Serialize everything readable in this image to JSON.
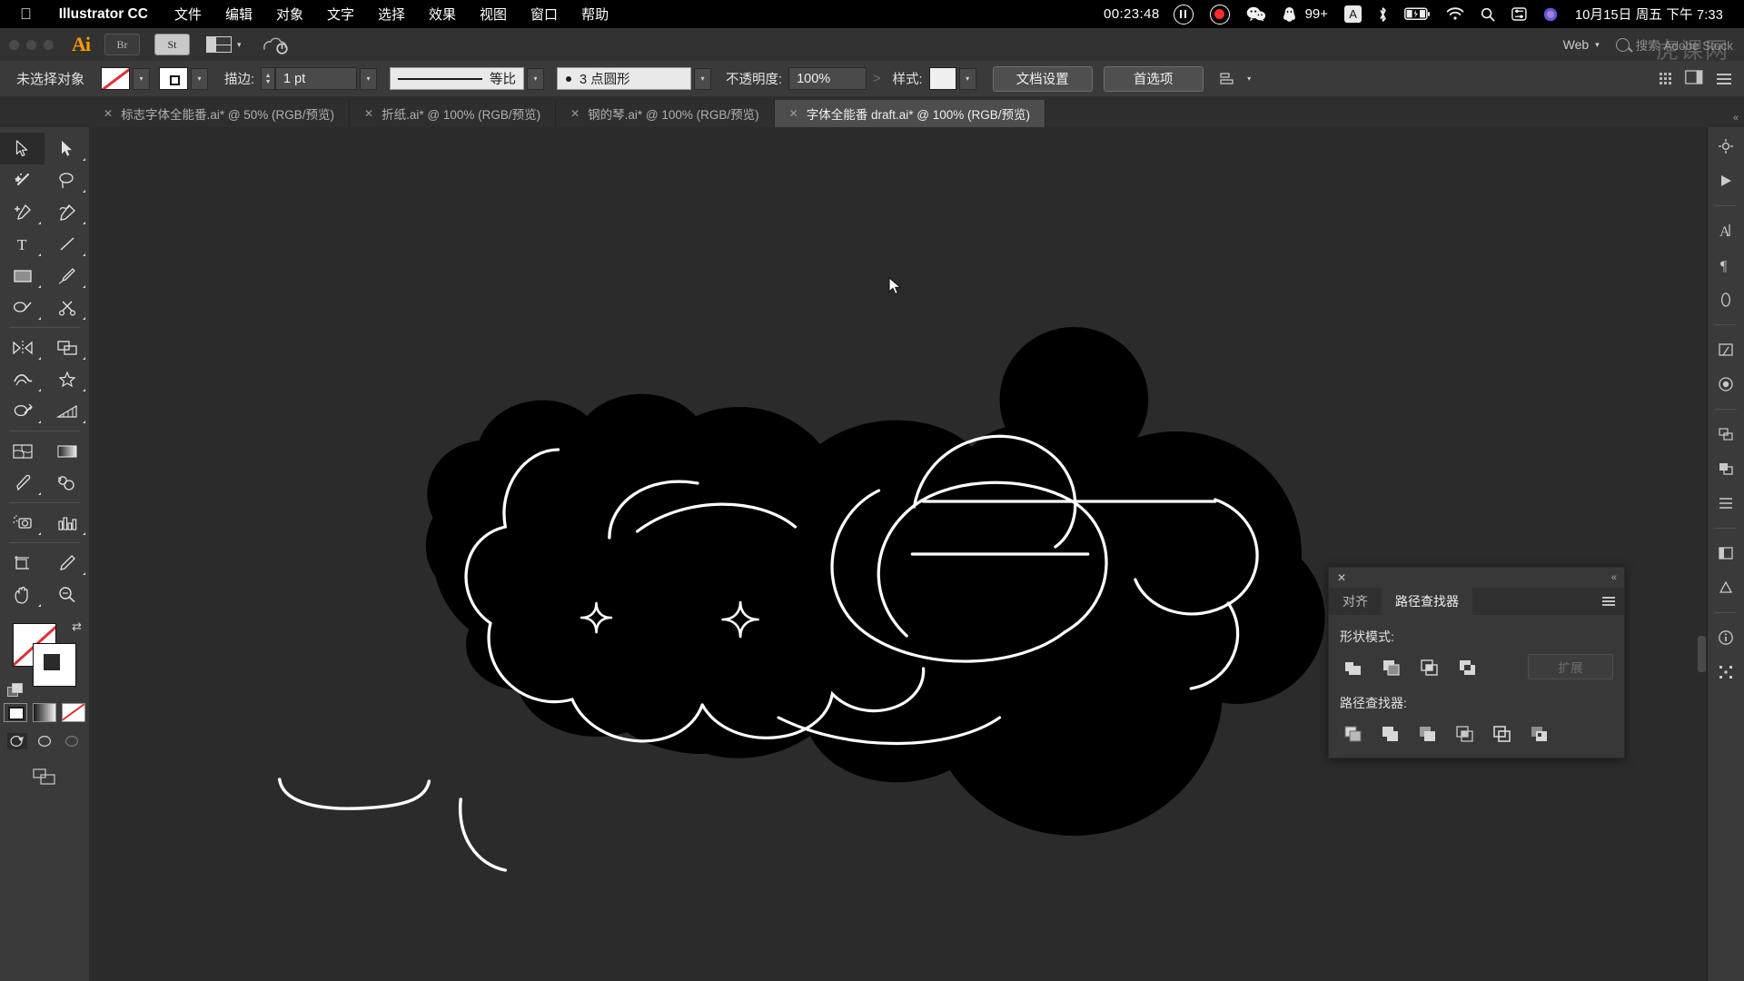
{
  "menubar": {
    "apple_icon": "apple-icon",
    "app_name": "Illustrator CC",
    "items": [
      "文件",
      "编辑",
      "对象",
      "文字",
      "选择",
      "效果",
      "视图",
      "窗口",
      "帮助"
    ],
    "rec_time": "00:23:48",
    "pause_icon": "pause-icon",
    "record_icon": "record-icon",
    "wechat_icon": "wechat-icon",
    "qq_icon": "qq-icon",
    "notification_count": "99+",
    "input_source": "A",
    "bluetooth_icon": "bluetooth-icon",
    "battery_icon": "battery-icon",
    "wifi_icon": "wifi-icon",
    "spotlight_icon": "search-icon",
    "controlcenter_icon": "control-center-icon",
    "siri_icon": "siri-icon",
    "datetime": "10月15日 周五 下午 7:33"
  },
  "appbar": {
    "logo": "Ai",
    "bridge_label": "Br",
    "stock_label": "St",
    "workspace_icon": "workspace-switcher-icon",
    "chevron": "⌄",
    "cloud_icon": "cloud-sync-icon",
    "workspace_name": "Web",
    "search_placeholder": "搜索 Adobe Stock",
    "watermark": "虎课网"
  },
  "controlbar": {
    "selection_status": "未选择对象",
    "fill_swatch": "none-swatch",
    "stroke_swatch": "stroke-swatch",
    "stroke_label": "描边:",
    "stroke_width": "1 pt",
    "profile_label": "等比",
    "brush_label": "3 点圆形",
    "opacity_label": "不透明度:",
    "opacity_value": "100%",
    "opacity_arrow": ">",
    "style_label": "样式:",
    "doc_setup": "文档设置",
    "preferences": "首选项",
    "align_icon": "align-icon",
    "grid_icon": "arrange-documents-icon",
    "panel_icon": "panel-toggle-icon",
    "menu_icon": "menu-icon"
  },
  "tabs": [
    {
      "label": "标志字体全能番.ai* @ 50% (RGB/预览)",
      "active": false
    },
    {
      "label": "折纸.ai* @ 100% (RGB/预览)",
      "active": false
    },
    {
      "label": "钢的琴.ai* @ 100% (RGB/预览)",
      "active": false
    },
    {
      "label": "字体全能番 draft.ai* @ 100% (RGB/预览)",
      "active": true
    }
  ],
  "toolbar": {
    "tools": [
      "selection-tool",
      "direct-selection-tool",
      "magic-wand-tool",
      "lasso-tool",
      "pen-tool",
      "curvature-tool",
      "type-tool",
      "line-segment-tool",
      "rectangle-tool",
      "paintbrush-tool",
      "shaper-tool",
      "scissors-tool",
      "rotate-tool",
      "scale-tool",
      "width-tool",
      "free-transform-tool",
      "shape-builder-tool",
      "perspective-grid-tool",
      "mesh-tool",
      "gradient-tool",
      "eyedropper-tool",
      "blend-tool",
      "symbol-sprayer-tool",
      "column-graph-tool",
      "artboard-tool",
      "slice-tool",
      "hand-tool",
      "zoom-tool"
    ],
    "fill_label": "fill-swatch",
    "stroke_label": "stroke-swatch",
    "swap_icon": "swap-fill-stroke-icon",
    "default_icon": "default-fill-stroke-icon",
    "paint_modes": [
      "color-mode",
      "gradient-mode",
      "none-mode"
    ],
    "screen_modes": [
      "normal-screen-mode",
      "full-screen-menu-mode",
      "full-screen-mode"
    ],
    "edit_toolbar_icon": "edit-toolbar-icon"
  },
  "pathfinder": {
    "close_icon": "close-icon",
    "collapse_icon": "collapse-panel-icon",
    "tabs": [
      {
        "label": "对齐",
        "active": false
      },
      {
        "label": "路径查找器",
        "active": true
      }
    ],
    "menu_icon": "panel-menu-icon",
    "shape_modes_label": "形状模式:",
    "shape_mode_buttons": [
      "unite-icon",
      "minus-front-icon",
      "intersect-icon",
      "exclude-icon"
    ],
    "expand_label": "扩展",
    "pathfinders_label": "路径查找器:",
    "pathfinder_buttons": [
      "divide-icon",
      "trim-icon",
      "merge-icon",
      "crop-icon",
      "outline-icon",
      "minus-back-icon"
    ]
  },
  "dock": {
    "items": [
      "properties-icon",
      "libraries-icon",
      "brushes-icon",
      "character-icon",
      "paragraph-icon",
      "transparency-icon",
      "artboards-icon",
      "gradient-icon",
      "pathfinder-icon",
      "appearance-icon",
      "transform-icon",
      "layers-icon",
      "swatches-icon",
      "color-guide-icon",
      "info-icon",
      "align-icon"
    ]
  },
  "canvas": {
    "cursor_icon": "arrow-cursor",
    "artwork_description": "black-bubble-lettering-artwork"
  },
  "colors": {
    "menubar_bg": "#000000",
    "app_chrome": "#323232",
    "control_bar": "#3a3a3a",
    "canvas_bg": "#2b2b2b",
    "panel_bg": "#383838",
    "accent_orange": "#ff9a00",
    "record_red": "#ff2d2d",
    "artwork_fill": "#000000",
    "artwork_stroke": "#ffffff"
  }
}
